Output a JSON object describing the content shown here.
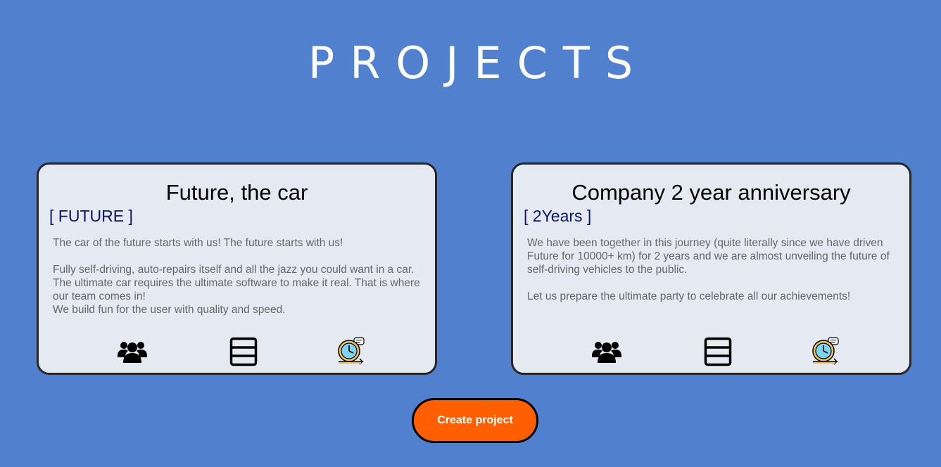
{
  "page": {
    "title": "PROJECTS"
  },
  "projects": [
    {
      "title": "Future, the car",
      "tag": "[ FUTURE ]",
      "description": "The car of the future starts with us! The future starts with us!\n\nFully self-driving, auto-repairs itself and all the jazz you could want in a car.\nThe ultimate car requires the ultimate software to make it real. That is where our team comes in!\nWe build fun for the user with quality and speed.",
      "icons": [
        "team-icon",
        "board-icon",
        "timeline-icon"
      ]
    },
    {
      "title": "Company 2 year anniversary",
      "tag": "[ 2Years ]",
      "description": "We have been together in this journey (quite literally since we have driven Future for 10000+ km) for 2 years and we are almost unveiling the future of self-driving vehicles to the public.\n\nLet us prepare the ultimate party to celebrate all our achievements!",
      "icons": [
        "team-icon",
        "board-icon",
        "timeline-icon"
      ]
    }
  ],
  "actions": {
    "create_label": "Create project"
  },
  "colors": {
    "background": "#5080ce",
    "card": "#e5e9f1",
    "tag": "#0b1468",
    "button": "#ff5f00"
  }
}
